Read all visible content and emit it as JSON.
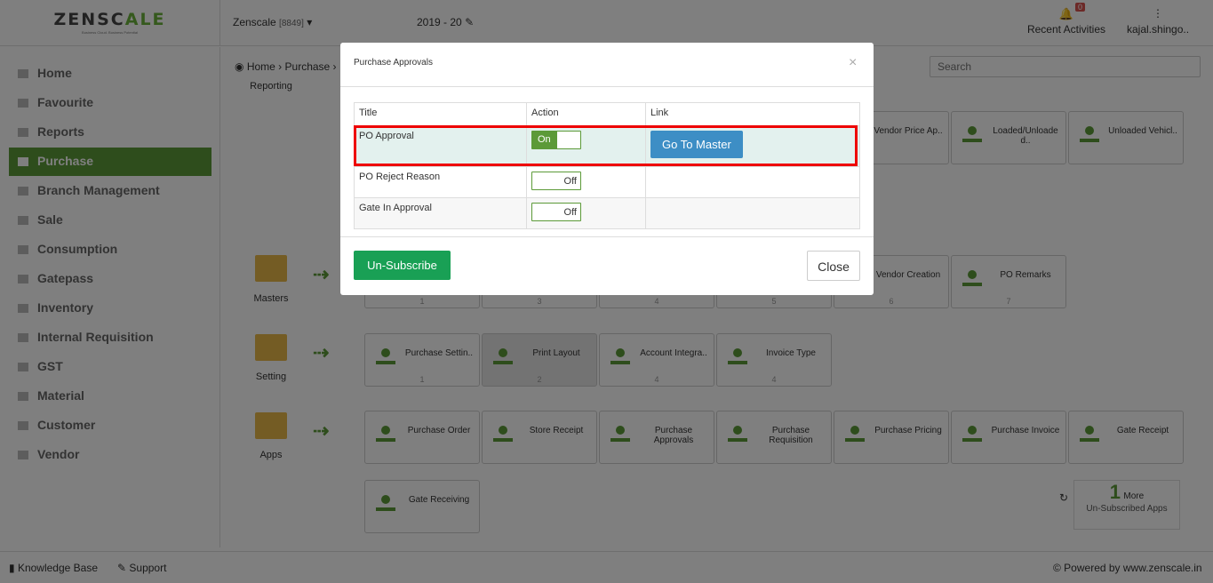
{
  "header": {
    "logo_main_a": "ZENSC",
    "logo_main_b": "ALE",
    "logo_tagline": "Business Cloud. Business Potential",
    "company_name": "Zenscale",
    "company_id": "[8849]",
    "fiscal_year": "2019 - 20",
    "recent_label": "Recent Activities",
    "notif_count": "0",
    "user_name": "kajal.shingo.."
  },
  "sidebar": {
    "items": [
      {
        "label": "Home"
      },
      {
        "label": "Favourite"
      },
      {
        "label": "Reports"
      },
      {
        "label": "Purchase"
      },
      {
        "label": "Branch Management"
      },
      {
        "label": "Sale"
      },
      {
        "label": "Consumption"
      },
      {
        "label": "Gatepass"
      },
      {
        "label": "Inventory"
      },
      {
        "label": "Internal Requisition"
      },
      {
        "label": "GST"
      },
      {
        "label": "Material"
      },
      {
        "label": "Customer"
      },
      {
        "label": "Vendor"
      }
    ],
    "active": "Purchase"
  },
  "breadcrumb": {
    "home": "Home",
    "module": "Purchase"
  },
  "search": {
    "placeholder": "Search"
  },
  "rows": {
    "reporting": "Reporting",
    "masters": "Masters",
    "setting": "Setting",
    "apps": "Apps"
  },
  "tiles": {
    "reporting": [
      "Vendor Price Ap..",
      "Loaded/Unloade d..",
      "Unloaded Vehicl.."
    ],
    "masters": [
      {
        "name": "Vendor Creation",
        "num": "6"
      },
      {
        "name": "PO Remarks",
        "num": "7"
      }
    ],
    "masters_hidden_nums": [
      "1",
      "3",
      "4",
      "5"
    ],
    "setting": [
      {
        "name": "Purchase Settin..",
        "num": "1"
      },
      {
        "name": "Print Layout",
        "num": "2"
      },
      {
        "name": "Account Integra..",
        "num": "4"
      },
      {
        "name": "Invoice Type",
        "num": "4"
      }
    ],
    "apps": [
      "Purchase Order",
      "Store Receipt",
      "Purchase Approvals",
      "Purchase Requisition",
      "Purchase Pricing",
      "Purchase Invoice",
      "Gate Receipt",
      "Gate Receiving"
    ]
  },
  "more": {
    "count": "1",
    "label": "More",
    "caption": "Un-Subscribed Apps"
  },
  "footer": {
    "knowledge": "Knowledge Base",
    "support": "Support",
    "powered": "© Powered by www.zenscale.in"
  },
  "modal": {
    "title": "Purchase Approvals",
    "close_x": "×",
    "headers": {
      "title": "Title",
      "action": "Action",
      "link": "Link"
    },
    "rows": [
      {
        "title": "PO Approval",
        "toggle": "On",
        "link": "Go To Master"
      },
      {
        "title": "PO Reject Reason",
        "toggle": "Off",
        "link": ""
      },
      {
        "title": "Gate In Approval",
        "toggle": "Off",
        "link": ""
      }
    ],
    "unsubscribe": "Un-Subscribe",
    "close": "Close"
  },
  "colors": {
    "accent": "#5c9a38",
    "primary_btn": "#3d8ec5",
    "unsub_btn": "#19a055",
    "highlight": "#e00000"
  }
}
